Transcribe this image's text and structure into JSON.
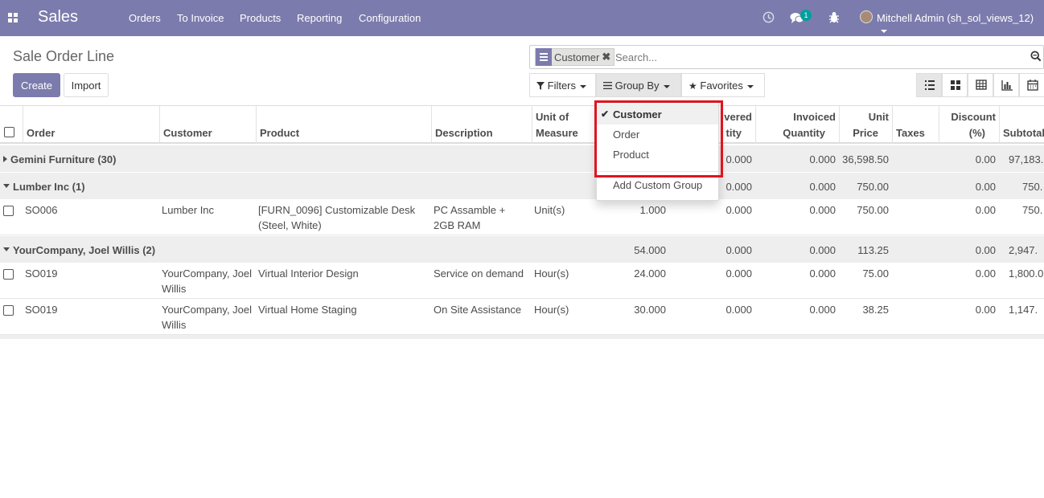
{
  "app": {
    "name": "Sales"
  },
  "nav": {
    "items": [
      "Orders",
      "To Invoice",
      "Products",
      "Reporting",
      "Configuration"
    ]
  },
  "systray": {
    "messages_count": "1",
    "user": "Mitchell Admin (sh_sol_views_12)"
  },
  "page": {
    "title": "Sale Order Line",
    "create_label": "Create",
    "import_label": "Import"
  },
  "search": {
    "facet_label": "Customer",
    "placeholder": "Search..."
  },
  "search_options": {
    "filters": "Filters",
    "group_by": "Group By",
    "favorites": "Favorites"
  },
  "groupby_menu": {
    "items": [
      "Customer",
      "Order",
      "Product"
    ],
    "selected": "Customer",
    "add_custom": "Add Custom Group"
  },
  "table": {
    "headers": {
      "order": "Order",
      "customer": "Customer",
      "product": "Product",
      "description": "Description",
      "uom_1": "Unit of",
      "uom_2": "Measure",
      "delivered_1": "vered",
      "delivered_2": "tity",
      "invoiced_1": "Invoiced",
      "invoiced_2": "Quantity",
      "price_1": "Unit",
      "price_2": "Price",
      "taxes": "Taxes",
      "discount_1": "Discount",
      "discount_2": "(%)",
      "subtotal": "Subtotal"
    },
    "groups": [
      {
        "label": "Gemini Furniture (30)",
        "delivered": "0.000",
        "invoiced": "0.000",
        "price": "36,598.50",
        "discount": "0.00",
        "subtotal": "97,183."
      },
      {
        "label": "Lumber Inc (1)",
        "delivered": "0.000",
        "invoiced": "0.000",
        "price": "750.00",
        "discount": "0.00",
        "subtotal": "750."
      },
      {
        "label": "YourCompany, Joel Willis (2)",
        "qty": "54.000",
        "delivered": "0.000",
        "invoiced": "0.000",
        "price": "113.25",
        "discount": "0.00",
        "subtotal": "2,947."
      }
    ],
    "rows": [
      {
        "order": "SO006",
        "customer_1": "Lumber Inc",
        "customer_2": "",
        "product_1": "[FURN_0096] Customizable Desk",
        "product_2": "(Steel, White)",
        "desc_1": "PC Assamble +",
        "desc_2": "2GB RAM",
        "uom": "Unit(s)",
        "qty": "1.000",
        "delivered": "0.000",
        "invoiced": "0.000",
        "price": "750.00",
        "discount": "0.00",
        "subtotal": "750."
      },
      {
        "order": "SO019",
        "customer_1": "YourCompany, Joel",
        "customer_2": "Willis",
        "product_1": "Virtual Interior Design",
        "product_2": "",
        "desc_1": "Service on demand",
        "desc_2": "",
        "uom": "Hour(s)",
        "qty": "24.000",
        "delivered": "0.000",
        "invoiced": "0.000",
        "price": "75.00",
        "discount": "0.00",
        "subtotal": "1,800.0"
      },
      {
        "order": "SO019",
        "customer_1": "YourCompany, Joel",
        "customer_2": "Willis",
        "product_1": "Virtual Home Staging",
        "product_2": "",
        "desc_1": "On Site Assistance",
        "desc_2": "",
        "uom": "Hour(s)",
        "qty": "30.000",
        "delivered": "0.000",
        "invoiced": "0.000",
        "price": "38.25",
        "discount": "0.00",
        "subtotal": "1,147."
      }
    ]
  },
  "colors": {
    "brand": "#7c7bad",
    "highlight": "#e0141e",
    "badge": "#00a09d"
  }
}
